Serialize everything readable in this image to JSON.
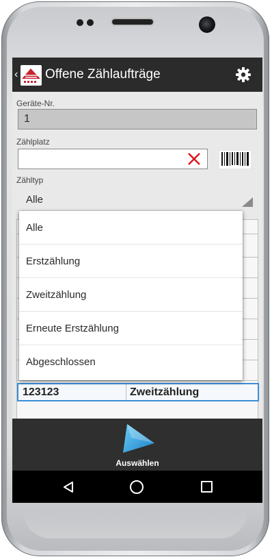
{
  "header": {
    "title": "Offene Zählaufträge"
  },
  "form": {
    "device_label": "Geräte-Nr.",
    "device_value": "1",
    "location_label": "Zählplatz",
    "location_value": "",
    "type_label": "Zähltyp",
    "type_value": "Alle"
  },
  "dropdown": {
    "options": [
      "Alle",
      "Erstzählung",
      "Zweitzählung",
      "Erneute Erstzählung",
      "Abgeschlossen"
    ]
  },
  "table": {
    "selected_row": {
      "number": "123123",
      "type": "Zweitzählung"
    }
  },
  "actions": {
    "select_label": "Auswählen"
  },
  "colors": {
    "appbar": "#2b2b2b",
    "clear_red": "#e0161c",
    "accent_blue": "#3b8ed8",
    "play_blue": "#2aa7e0"
  }
}
